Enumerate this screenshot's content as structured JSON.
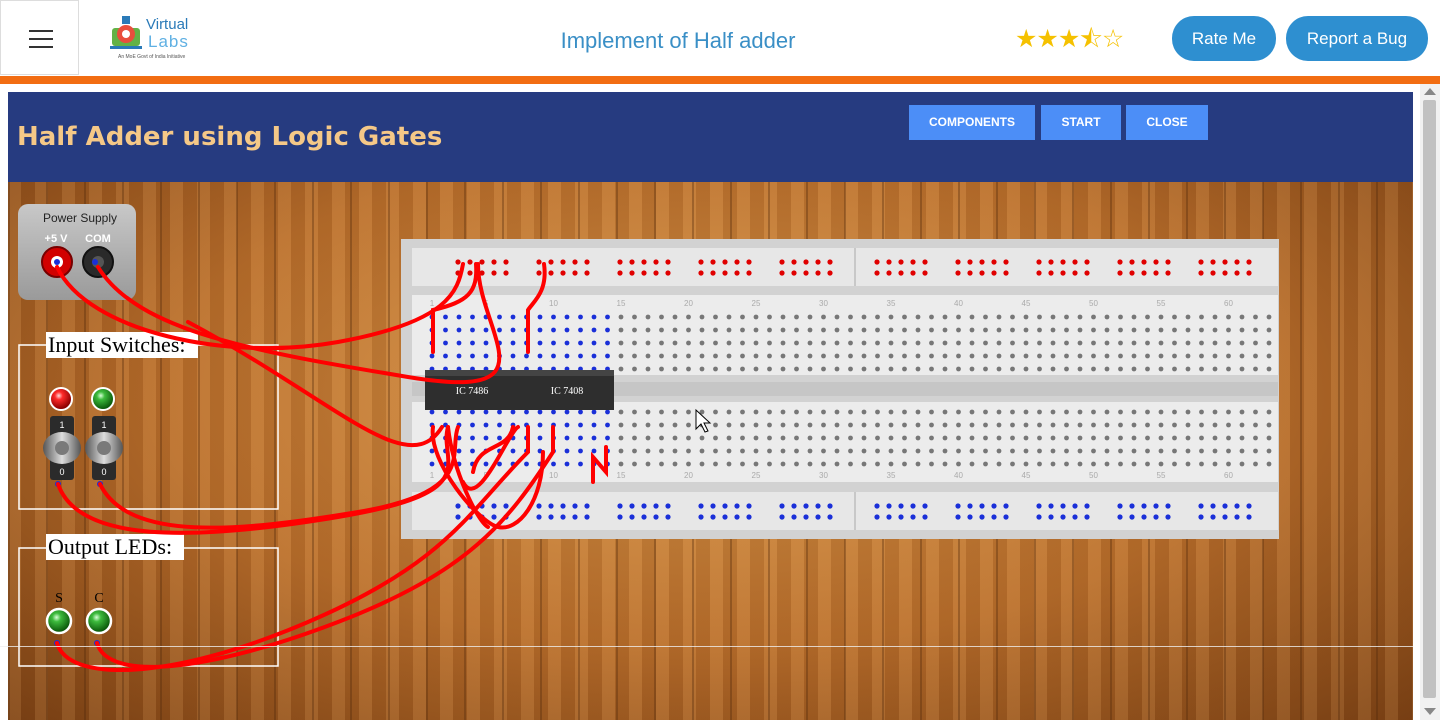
{
  "header": {
    "menu_icon": "hamburger-menu-icon",
    "logo": {
      "line1": "Virtual",
      "line2": "Labs",
      "tagline": "An MoE Govt of India Initiative"
    },
    "title": "Implement of Half adder",
    "rating": {
      "value": 3.5,
      "max": 5,
      "display": "★★★⯪☆"
    },
    "rate_button": "Rate Me",
    "bug_button": "Report a Bug"
  },
  "colors": {
    "accent_orange": "#f26d12",
    "header_blue": "#263b80",
    "title_gold": "#f5c887",
    "button_blue": "#4c8ef7",
    "wire_red": "#ff0000"
  },
  "simulator": {
    "title": "Half Adder using Logic Gates",
    "buttons": {
      "components": "COMPONENTS",
      "start": "START",
      "close": "CLOSE"
    },
    "power_supply": {
      "title": "Power Supply",
      "plus_label": "+5 V",
      "com_label": "COM"
    },
    "input_switches": {
      "title": "Input Switches:",
      "switch_on": "1",
      "switch_off": "0"
    },
    "output_leds": {
      "title": "Output LEDs:",
      "s_label": "S",
      "c_label": "C"
    },
    "ics": [
      {
        "label": "IC 7486"
      },
      {
        "label": "IC 7408"
      }
    ],
    "breadboard": {
      "column_numbers": [
        "1",
        "5",
        "10",
        "15",
        "20",
        "25",
        "30",
        "35",
        "40",
        "45",
        "50",
        "55",
        "60"
      ]
    }
  }
}
